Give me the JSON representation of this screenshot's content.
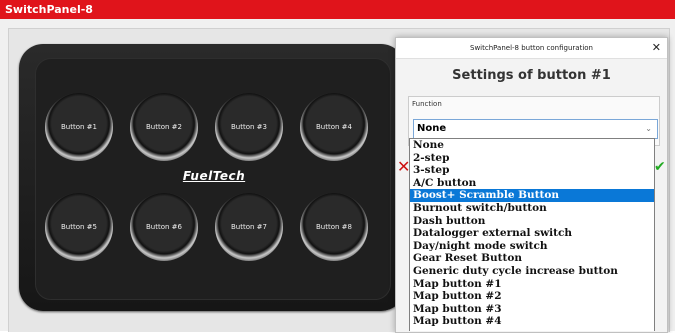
{
  "window": {
    "title": "SwitchPanel-8"
  },
  "panel": {
    "logo": "FuelTech",
    "buttons": [
      "Button #1",
      "Button #2",
      "Button #3",
      "Button #4",
      "Button #5",
      "Button #6",
      "Button #7",
      "Button #8"
    ]
  },
  "dialog": {
    "title": "SwitchPanel-8 button configuration",
    "close": "✕",
    "heading": "Settings of button #1",
    "function_label": "Function",
    "selected_value": "None",
    "cancel_icon": "x-icon",
    "confirm_icon": "check-icon",
    "options": [
      "None",
      "2-step",
      "3-step",
      "A/C button",
      "Boost+ Scramble Button",
      "Burnout switch/button",
      "Dash button",
      "Datalogger external switch",
      "Day/night mode switch",
      "Gear Reset Button",
      "Generic duty cycle increase button",
      "Map button #1",
      "Map button #2",
      "Map button #3",
      "Map button #4"
    ],
    "highlighted_option": "Boost+ Scramble Button"
  }
}
